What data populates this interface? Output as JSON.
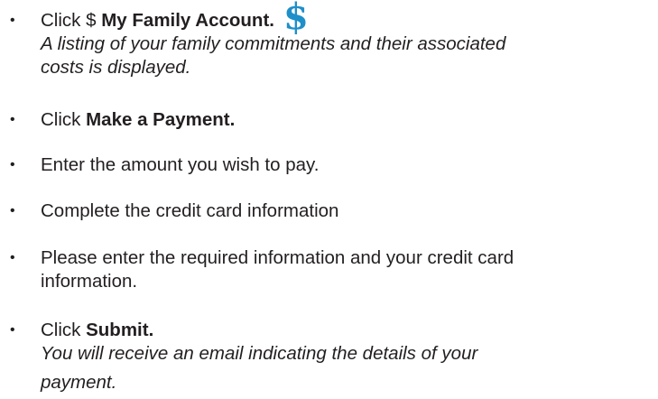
{
  "bullet_char": "•",
  "steps": [
    {
      "prefix": "Click $ ",
      "bold": "My Family Account.",
      "icon": "dollar-icon",
      "icon_glyph": "$",
      "note_line1": "A listing of your family commitments and their associated",
      "note_line2": "costs is displayed."
    },
    {
      "prefix": "Click ",
      "bold": "Make a Payment."
    },
    {
      "text": "Enter the amount you wish to pay."
    },
    {
      "text": "Complete the credit card information"
    },
    {
      "line1": "Please enter the required information and your credit card",
      "line2": "information."
    },
    {
      "prefix": "Click ",
      "bold": "Submit.",
      "note_line1": "You will receive an email indicating the details of your",
      "note_line2": "payment."
    }
  ]
}
